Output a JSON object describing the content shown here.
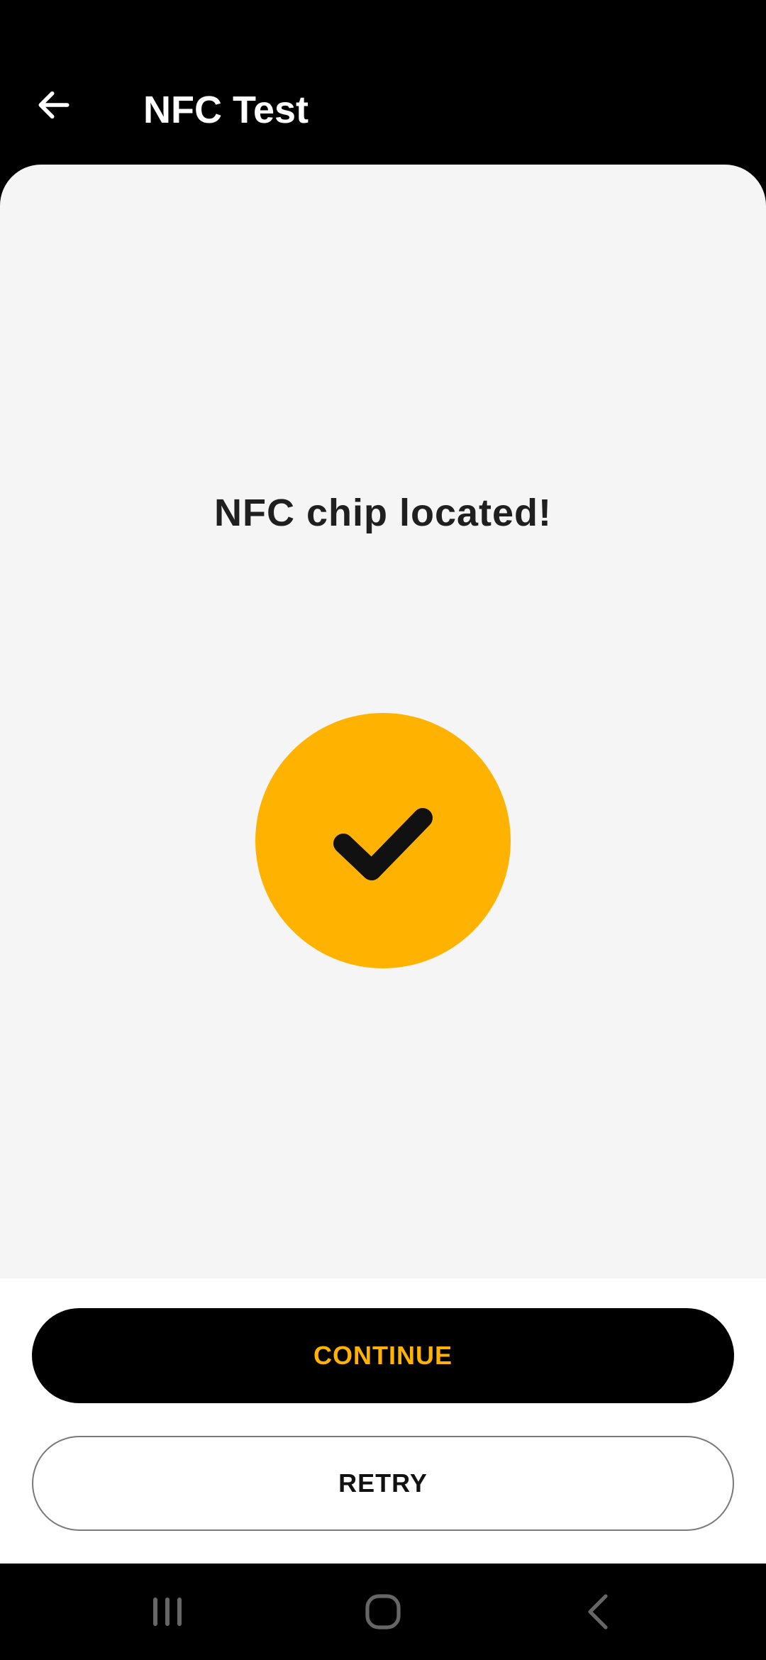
{
  "app_bar": {
    "title": "NFC Test",
    "back_icon": "arrow-left-icon"
  },
  "main": {
    "status_text": "NFC chip located!",
    "status_icon": "checkmark-icon"
  },
  "actions": {
    "continue_label": "CONTINUE",
    "retry_label": "RETRY"
  },
  "system_nav": {
    "recents_icon": "recents-icon",
    "home_icon": "home-icon",
    "back_icon": "back-chevron-icon"
  },
  "colors": {
    "accent": "#FFB300",
    "background": "#000000",
    "card": "#F5F5F5",
    "text_dark": "#1F1F1F"
  }
}
